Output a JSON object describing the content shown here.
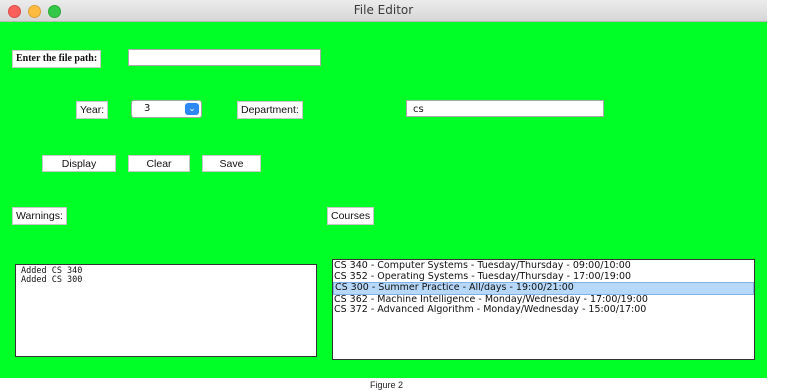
{
  "window": {
    "title": "File Editor"
  },
  "file_path": {
    "label": "Enter the file path:",
    "value": ""
  },
  "year": {
    "label": "Year:",
    "selected": "3"
  },
  "department": {
    "label": "Department:",
    "value": "cs"
  },
  "buttons": {
    "display": "Display",
    "clear": "Clear",
    "save": "Save"
  },
  "warnings": {
    "label": "Warnings:",
    "lines": [
      "Added CS 340",
      "Added CS 300"
    ]
  },
  "courses": {
    "label": "Courses",
    "items": [
      "CS 340 - Computer Systems - Tuesday/Thursday - 09:00/10:00",
      "CS 352 - Operating Systems - Tuesday/Thursday - 17:00/19:00",
      "CS 300 - Summer Practice - All/days - 19:00/21:00",
      "CS 362 - Machine Intelligence - Monday/Wednesday - 17:00/19:00",
      "CS 372 - Advanced Algorithm - Monday/Wednesday - 15:00/17:00"
    ],
    "selected_index": 2
  },
  "caption": "Figure 2"
}
